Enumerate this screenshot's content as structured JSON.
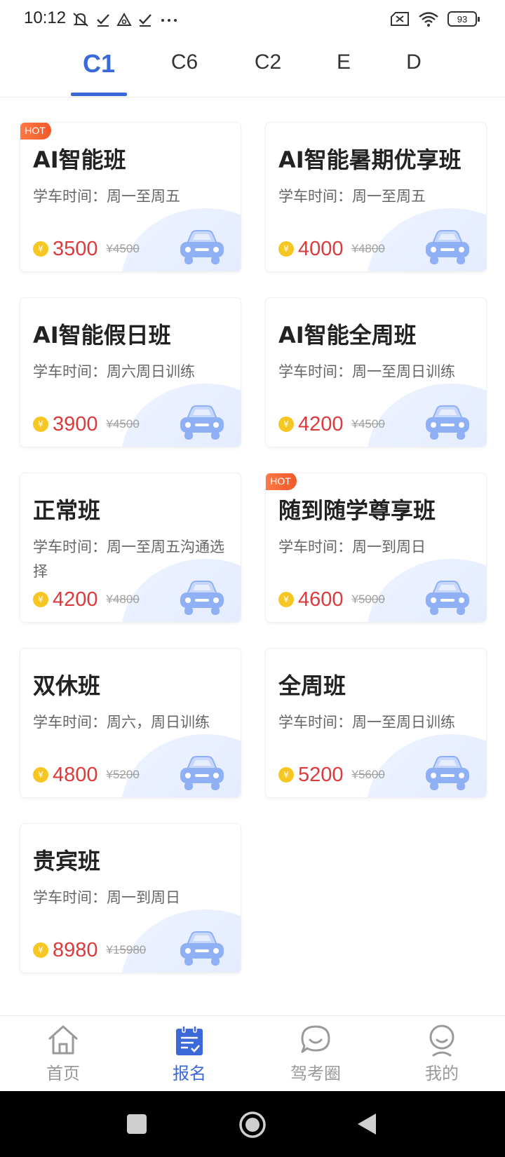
{
  "status_bar": {
    "time": "10:12",
    "battery": "93"
  },
  "tabs": [
    "C1",
    "C6",
    "C2",
    "E",
    "D"
  ],
  "active_tab": "C1",
  "cards": [
    {
      "title": "AI智能班",
      "time": "学车时间：周一至周五",
      "price": "3500",
      "old_price": "¥4500",
      "hot": true
    },
    {
      "title": "AI智能暑期优享班",
      "time": "学车时间：周一至周五",
      "price": "4000",
      "old_price": "¥4800",
      "hot": false
    },
    {
      "title": "AI智能假日班",
      "time": "学车时间：周六周日训练",
      "price": "3900",
      "old_price": "¥4500",
      "hot": false
    },
    {
      "title": "AI智能全周班",
      "time": "学车时间：周一至周日训练",
      "price": "4200",
      "old_price": "¥4500",
      "hot": false
    },
    {
      "title": "正常班",
      "time": "学车时间：周一至周五沟通选择",
      "price": "4200",
      "old_price": "¥4800",
      "hot": false
    },
    {
      "title": "随到随学尊享班",
      "time": "学车时间：周一到周日",
      "price": "4600",
      "old_price": "¥5000",
      "hot": true
    },
    {
      "title": "双休班",
      "time": "学车时间：周六，周日训练",
      "price": "4800",
      "old_price": "¥5200",
      "hot": false
    },
    {
      "title": "全周班",
      "time": "学车时间：周一至周日训练",
      "price": "5200",
      "old_price": "¥5600",
      "hot": false
    },
    {
      "title": "贵宾班",
      "time": "学车时间：周一到周日",
      "price": "8980",
      "old_price": "¥15980",
      "hot": false
    }
  ],
  "hot_label": "HOT",
  "coin_symbol": "¥",
  "bottom_nav": [
    {
      "label": "首页",
      "icon": "home-icon"
    },
    {
      "label": "报名",
      "icon": "signup-icon"
    },
    {
      "label": "驾考圈",
      "icon": "chat-icon"
    },
    {
      "label": "我的",
      "icon": "profile-icon"
    }
  ],
  "active_nav": "报名",
  "colors": {
    "accent": "#3b6ad8",
    "price": "#e0393b",
    "hot": "#f1592a",
    "coin": "#f6c623"
  }
}
